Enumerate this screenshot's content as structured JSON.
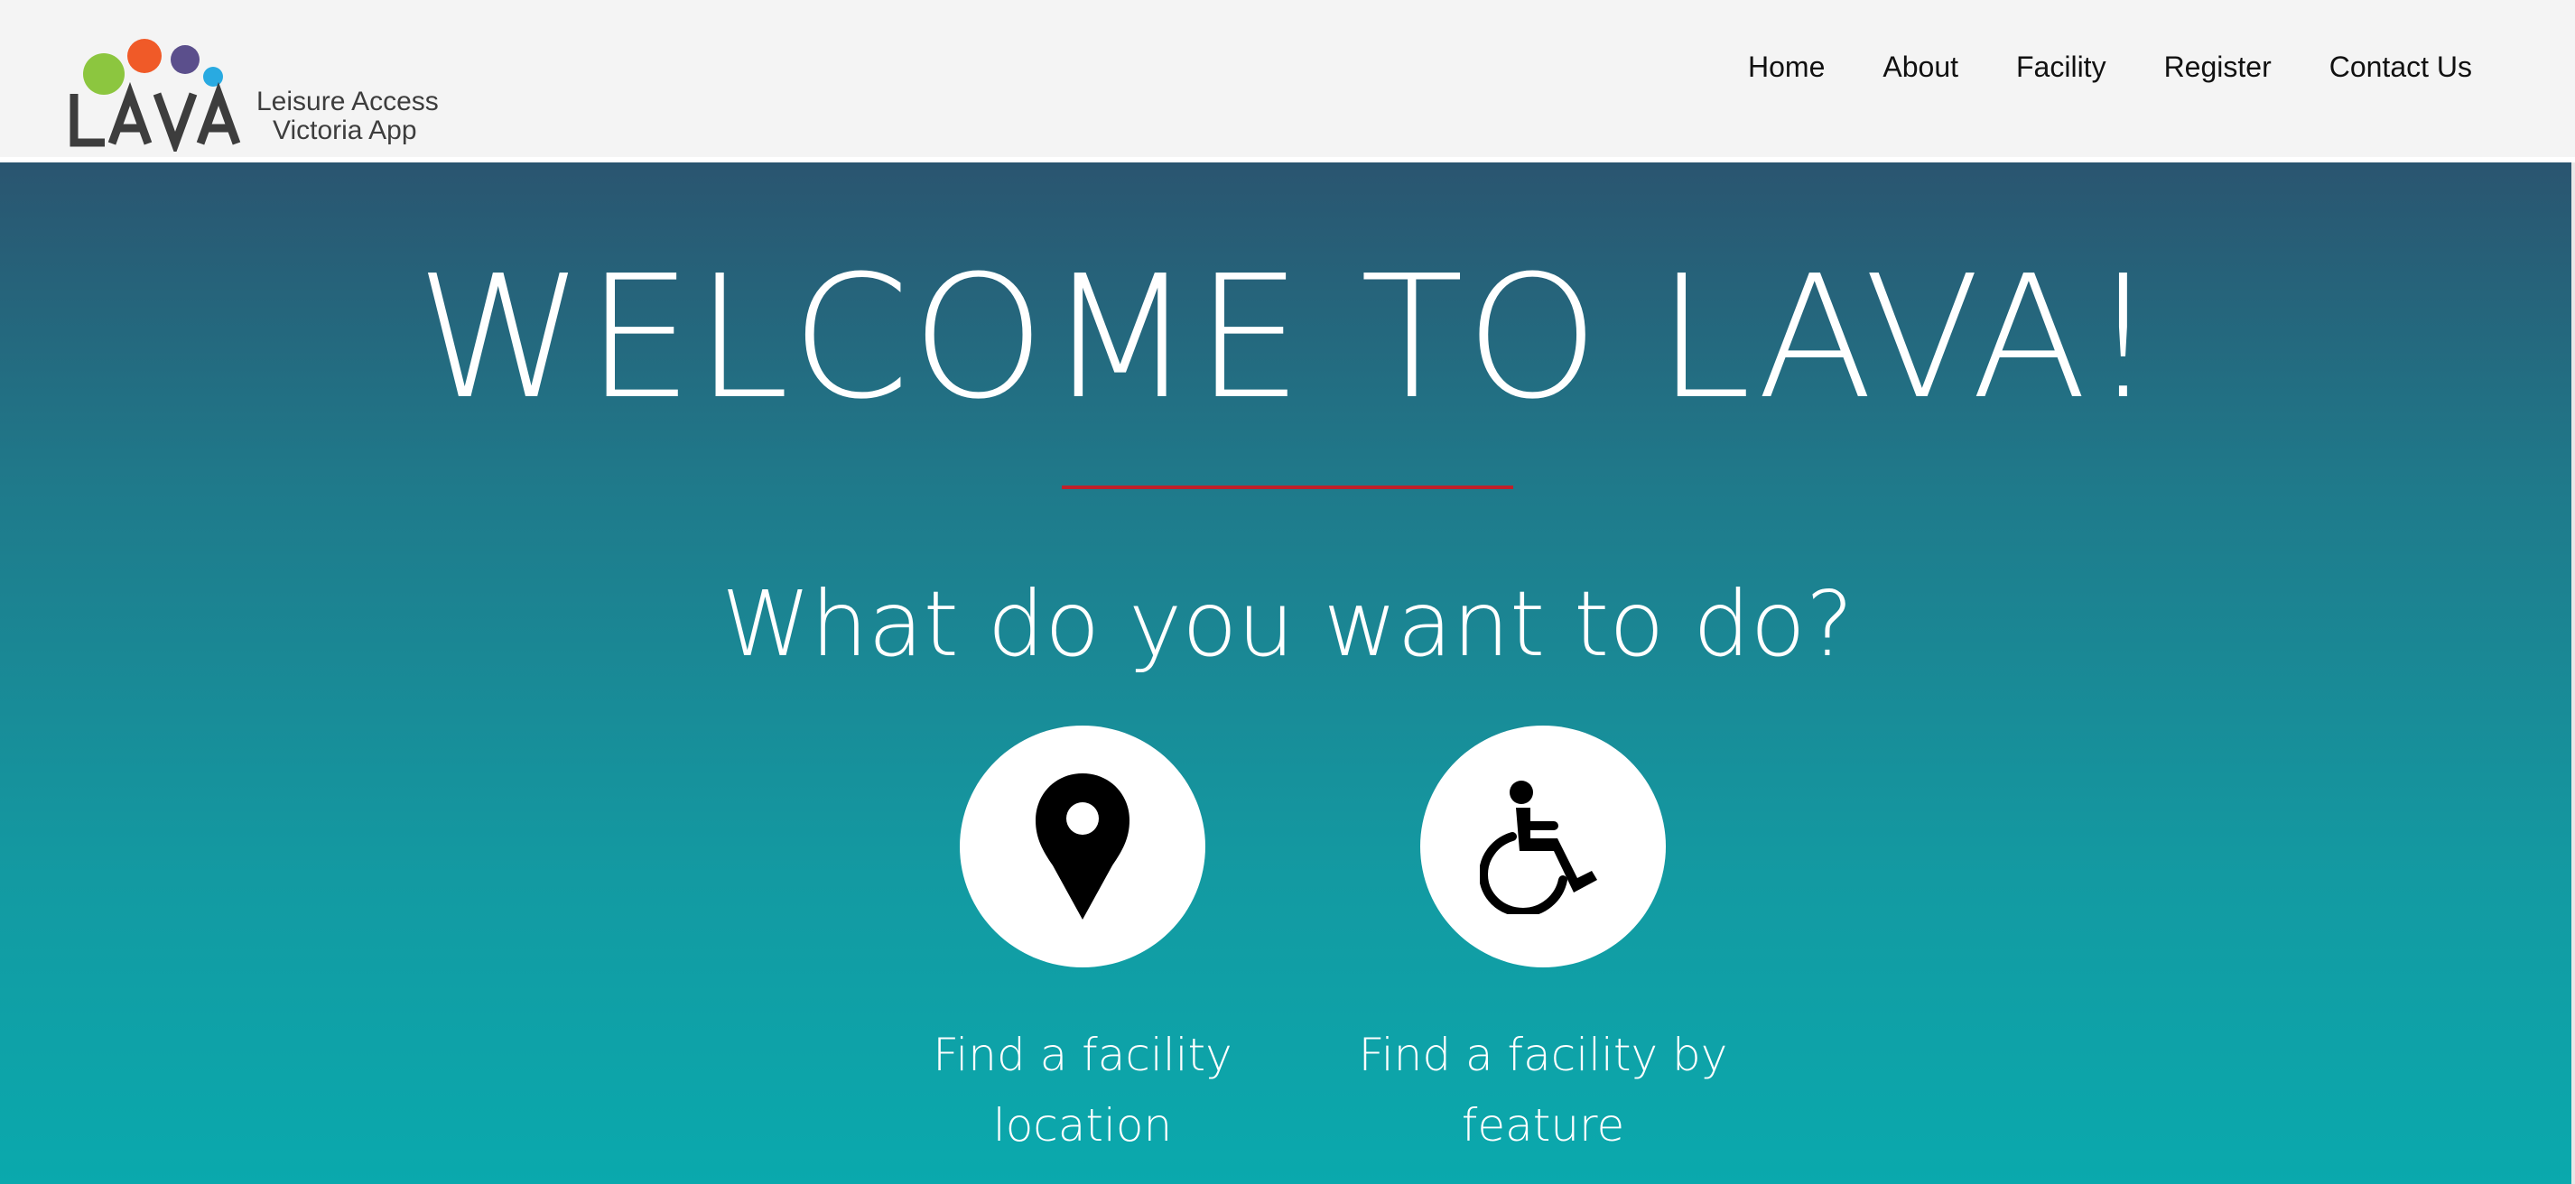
{
  "logo": {
    "wordmark": "LAVA",
    "tagline_line1": "Leisure Access",
    "tagline_line2": "Victoria App",
    "dot_colors": [
      "#8cc63f",
      "#f05a28",
      "#5b4f8c",
      "#29aae1"
    ],
    "wordmark_color": "#3d3d3d"
  },
  "nav": {
    "items": [
      {
        "label": "Home"
      },
      {
        "label": "About"
      },
      {
        "label": "Facility"
      },
      {
        "label": "Register"
      },
      {
        "label": "Contact Us"
      }
    ]
  },
  "hero": {
    "title": "WELCOME TO LAVA!",
    "subtitle": "What do you want to do?",
    "accent_rule_color": "#c0202a",
    "gradient": [
      "#2a5570",
      "#0aa9ad"
    ],
    "actions": [
      {
        "icon": "location-pin-icon",
        "label": "Find a facility location"
      },
      {
        "icon": "wheelchair-icon",
        "label": "Find a facility by feature"
      }
    ]
  }
}
